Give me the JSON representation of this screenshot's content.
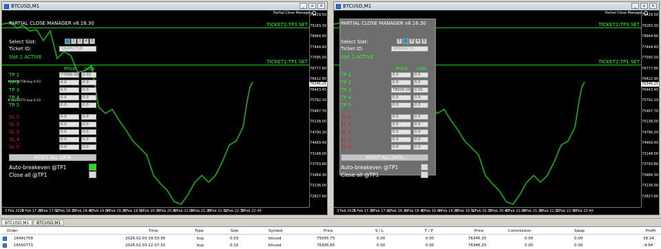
{
  "windows": [
    {
      "title": "BTCUSD,M1",
      "pcm_tag": "Partial Close Manager",
      "y_labels": [
        "79429.50",
        "79183.30",
        "78944.90",
        "77444.40",
        "77095.50",
        "76777.80",
        "76422.90",
        "76443.45",
        "75792.10",
        "75467.70",
        "75138.00",
        "74790.20",
        "74469.40",
        "73148.00",
        "73793.80",
        "73484.30",
        "73136.00",
        "72827.60"
      ],
      "x_labels": [
        "3 Feb 2026",
        "3 Feb 17:28",
        "3 Feb 17:52",
        "3 Feb 18:16",
        "3 Feb 18:40",
        "3 Feb 19:04",
        "3 Feb 19:28",
        "3 Feb 19:52",
        "3 Feb 20:16",
        "3 Feb 20:40",
        "3 Feb 21:04",
        "3 Feb 21:28",
        "3 Feb 21:52",
        "3 Feb 22:16",
        "3 Feb 22:40"
      ],
      "price_flag": "76346.25",
      "lines": [
        {
          "label": "TICKET2:TP3 SET"
        },
        {
          "label": "TICKET1:TP1 SET"
        }
      ],
      "buy_labels": [
        "#16491758 buy 0.03",
        "#16550771 buy 0.10"
      ],
      "panel": {
        "title": "PARTIAL CLOSE MANAGER v8.16.30",
        "select_slot": "Select Slot:",
        "slots": [
          "1",
          "2",
          "3",
          "4",
          "5"
        ],
        "active_slot": 1,
        "ticket_label": "Ticket ID:",
        "ticket_value": "16491758",
        "status": "Slot 1 ACTIVE",
        "col_price": "Price",
        "col_lots": "Lots",
        "tp_rows": [
          {
            "label": "TP 1",
            "price": "77000.00",
            "lots": "0.02"
          },
          {
            "label": "TP 2",
            "price": "0.0",
            "lots": "0.0"
          },
          {
            "label": "TP 3",
            "price": "0.0",
            "lots": "0.0"
          },
          {
            "label": "TP 4",
            "price": "0.0",
            "lots": "0.0"
          },
          {
            "label": "TP 5",
            "price": "0.0",
            "lots": "0.0"
          }
        ],
        "sl_rows": [
          {
            "label": "SL 1",
            "price": "0.0",
            "lots": "0.0"
          },
          {
            "label": "SL 2",
            "price": "0.0",
            "lots": "0.0"
          },
          {
            "label": "SL 3",
            "price": "0.0",
            "lots": "0.0"
          },
          {
            "label": "SL 4",
            "price": "0.0",
            "lots": "0.0"
          },
          {
            "label": "SL 5",
            "price": "0.0",
            "lots": "0.0"
          }
        ],
        "reset_label": "RESET ALL DATA",
        "opt1": "Auto-breakeven @TP1",
        "opt1_on": true,
        "opt2": "Close all @TP1",
        "opt2_on": false
      }
    },
    {
      "title": "BTCUSD,M1",
      "pcm_tag": "Partial Close Manager",
      "y_labels": [
        "79429.50",
        "79183.30",
        "78944.90",
        "77444.40",
        "77095.50",
        "76777.80",
        "76422.90",
        "76443.45",
        "75792.10",
        "75467.70",
        "75138.00",
        "74790.20",
        "74469.40",
        "73148.00",
        "73793.80",
        "73484.30",
        "73136.00",
        "72827.60"
      ],
      "x_labels": [
        "3 Feb 2026",
        "3 Feb 17:28",
        "3 Feb 17:52",
        "3 Feb 18:16",
        "3 Feb 18:40",
        "3 Feb 19:04",
        "3 Feb 19:28",
        "3 Feb 19:52",
        "3 Feb 20:16",
        "3 Feb 20:40",
        "3 Feb 21:04",
        "3 Feb 21:28",
        "3 Feb 21:52",
        "3 Feb 22:16",
        "3 Feb 22:40"
      ],
      "price_flag": "76346.25",
      "lines": [
        {
          "label": "TICKET2:TP3 SET"
        },
        {
          "label": "TICKET2:TP1 SET"
        }
      ],
      "panel": {
        "title": "PARTIAL CLOSE MANAGER v8.16.30",
        "select_slot": "Select Slot:",
        "slots": [
          "1",
          "2",
          "3",
          "4",
          "5"
        ],
        "active_slot": 2,
        "ticket_label": "Ticket ID:",
        "ticket_value": "16550771",
        "status": "Slot 2 ACTIVE",
        "col_price": "Price",
        "col_lots": "Lots",
        "tp_rows": [
          {
            "label": "TP 1",
            "price": "0.0",
            "lots": "0.0"
          },
          {
            "label": "TP 2",
            "price": "0.0",
            "lots": "0.0"
          },
          {
            "label": "TP 3",
            "price": "78000.00",
            "lots": "0.01"
          },
          {
            "label": "TP 4",
            "price": "0.0",
            "lots": "0.0"
          },
          {
            "label": "TP 5",
            "price": "0.0",
            "lots": "0.0"
          }
        ],
        "sl_rows": [
          {
            "label": "SL 1",
            "price": "0.0",
            "lots": "0.0"
          },
          {
            "label": "SL 2",
            "price": "0.0",
            "lots": "0.0"
          },
          {
            "label": "SL 3",
            "price": "0.0",
            "lots": "0.0"
          },
          {
            "label": "SL 4",
            "price": "0.0",
            "lots": "0.0"
          },
          {
            "label": "SL 5",
            "price": "0.0",
            "lots": "0.0"
          }
        ],
        "reset_label": "RESET ALL DATA",
        "opt1": "Auto-breakeven @TP1",
        "opt1_on": false,
        "opt2": "Close all @TP1",
        "opt2_on": false
      }
    }
  ],
  "tabs": [
    "BTCUSD,M1",
    "BTCUSD,M1"
  ],
  "terminal": {
    "headers": [
      "Order",
      "Time",
      "Type",
      "Size",
      "Symbol",
      "Price",
      "S / L",
      "T / P",
      "Price",
      "Commission",
      "Swap",
      "Profit"
    ],
    "rows": [
      [
        "16491758",
        "2026.02.03 19:33:36",
        "buy",
        "0.03",
        "btcusd",
        "75055.75",
        "0.00",
        "0.00",
        "76346.25",
        "0.00",
        "0.00",
        "39.24"
      ],
      [
        "16550771",
        "2026.02.03 22:37:31",
        "buy",
        "0.10",
        "btcusd",
        "76395.65",
        "0.00",
        "0.00",
        "76346.25",
        "0.00",
        "0.00",
        "-4.94"
      ]
    ]
  }
}
